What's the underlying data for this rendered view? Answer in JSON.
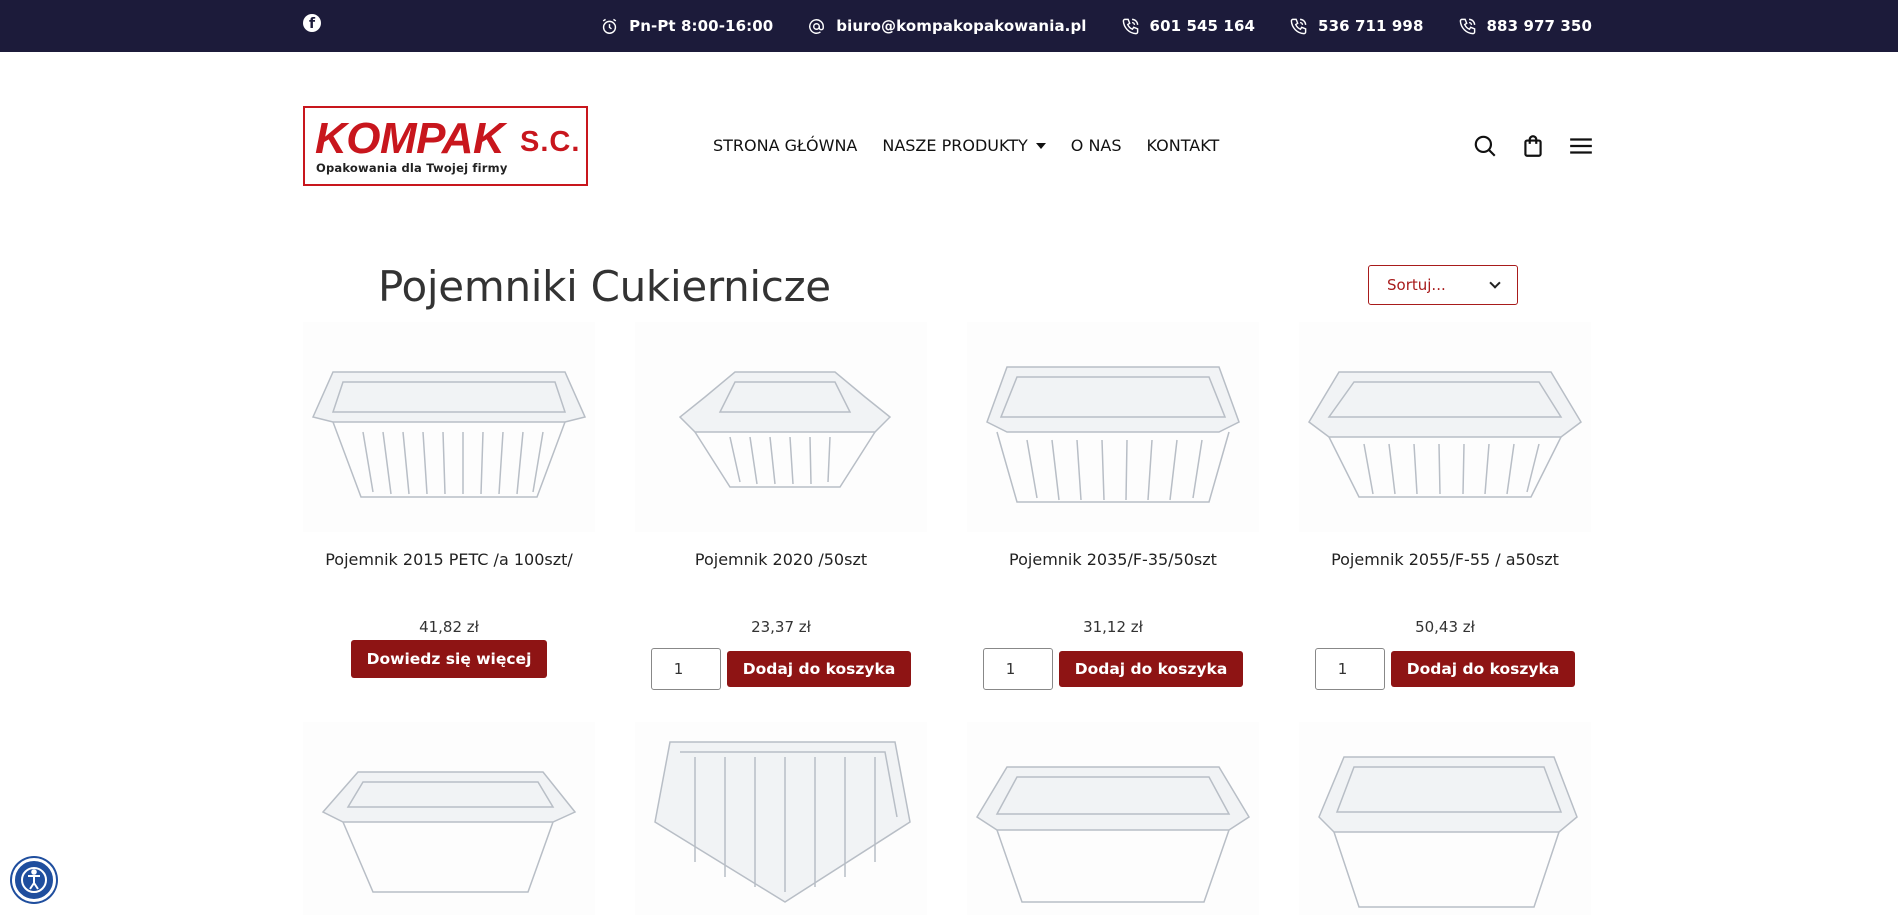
{
  "topbar": {
    "facebook_icon": "facebook-icon",
    "hours": "Pn-Pt 8:00-16:00",
    "email": "biuro@kompakopakowania.pl",
    "phones": [
      "601 545 164",
      "536 711 998",
      "883 977 350"
    ]
  },
  "logo": {
    "name": "KOMPAK",
    "suffix": "S.C.",
    "tagline": "Opakowania dla Twojej firmy"
  },
  "nav": {
    "items": [
      "STRONA GŁÓWNA",
      "NASZE PRODUKTY",
      "O NAS",
      "KONTAKT"
    ]
  },
  "header_icons": [
    "search-icon",
    "cart-icon",
    "menu-icon"
  ],
  "page": {
    "title": "Pojemniki Cukiernicze",
    "sort_label": "Sortuj..."
  },
  "products": [
    {
      "name": "Pojemnik 2015 PETC /a 100szt/",
      "price": "41,82 zł",
      "button": "Dowiedz się więcej",
      "qty": null
    },
    {
      "name": "Pojemnik 2020 /50szt",
      "price": "23,37 zł",
      "button": "Dodaj do koszyka",
      "qty": "1"
    },
    {
      "name": "Pojemnik 2035/F-35/50szt",
      "price": "31,12 zł",
      "button": "Dodaj do koszyka",
      "qty": "1"
    },
    {
      "name": "Pojemnik 2055/F-55 / a50szt",
      "price": "50,43 zł",
      "button": "Dodaj do koszyka",
      "qty": "1"
    }
  ],
  "colors": {
    "topbar_bg": "#1c1b3a",
    "brand_red": "#c8161d",
    "button_red": "#8e1414"
  }
}
